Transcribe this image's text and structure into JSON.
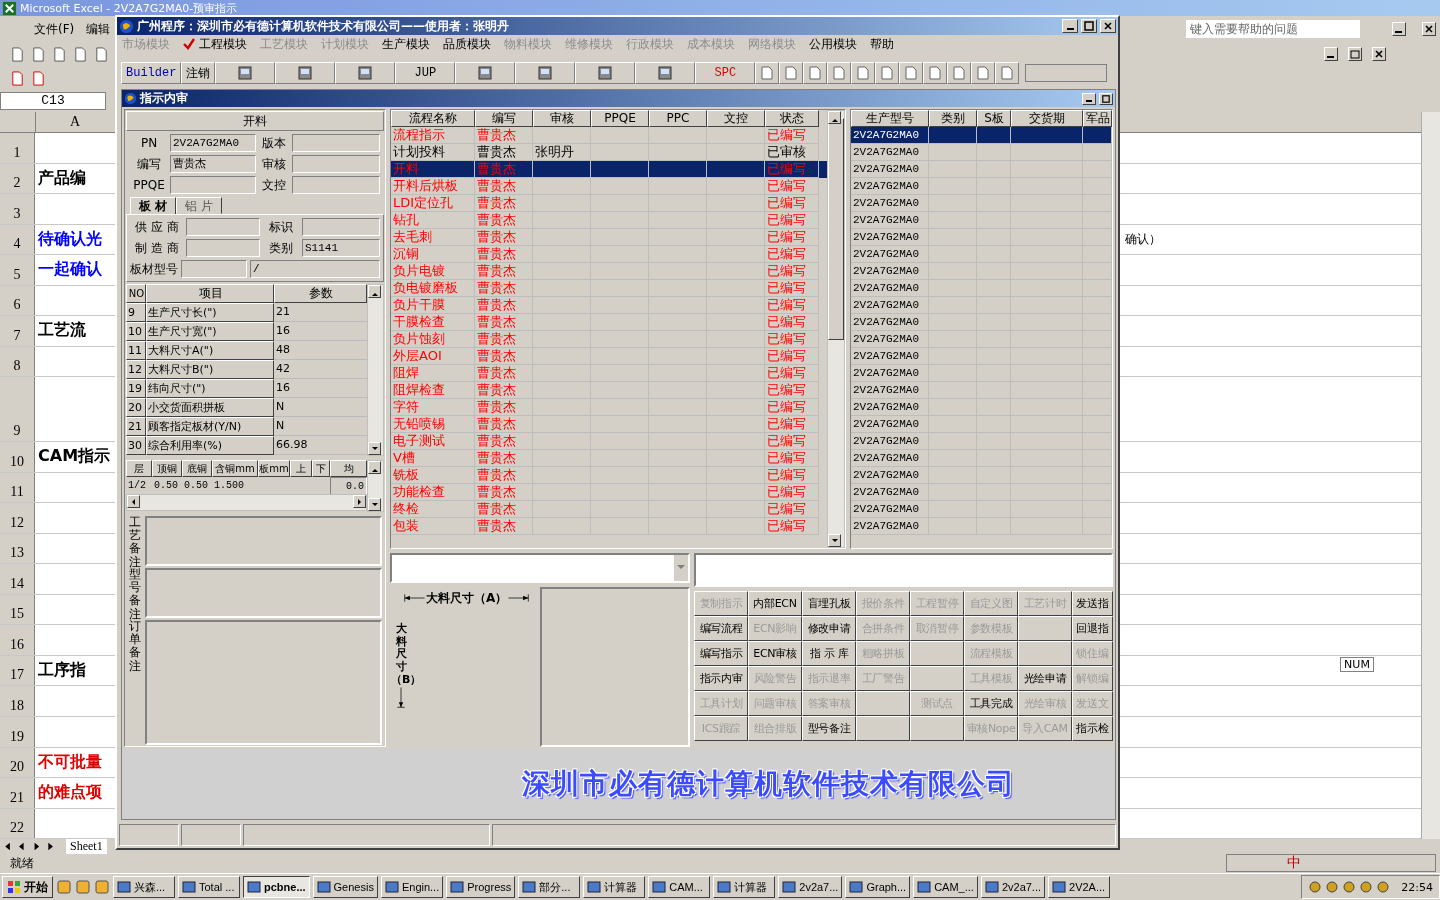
{
  "excel": {
    "title": "Microsoft Excel - 2V2A7G2MA0-预审指示",
    "menu": [
      "文件(F)",
      "编辑"
    ],
    "help_placeholder": "键入需要帮助的问题",
    "name_box": "C13",
    "column": "A",
    "rows": [
      {
        "num": "1"
      },
      {
        "num": "2",
        "text": "产品编",
        "color": "#000000"
      },
      {
        "num": "3"
      },
      {
        "num": "4",
        "text": "待确认光",
        "color": "#0000ff",
        "note": "确认）"
      },
      {
        "num": "5",
        "text": "一起确认",
        "color": "#0000ff"
      },
      {
        "num": "6"
      },
      {
        "num": "7",
        "text": "工艺流",
        "color": "#000000"
      },
      {
        "num": "8"
      },
      {
        "num": "9"
      },
      {
        "num": "10",
        "text": "CAM指示",
        "color": "#000000"
      },
      {
        "num": "11"
      },
      {
        "num": "12"
      },
      {
        "num": "13"
      },
      {
        "num": "14"
      },
      {
        "num": "15"
      },
      {
        "num": "16"
      },
      {
        "num": "17",
        "text": "工序指",
        "color": "#000000"
      },
      {
        "num": "18"
      },
      {
        "num": "19"
      },
      {
        "num": "20",
        "text": "不可批量",
        "color": "#e00000"
      },
      {
        "num": "21",
        "text": "的难点项",
        "color": "#e00000"
      },
      {
        "num": "22"
      }
    ],
    "sheet_tab": "Sheet1",
    "status": "就绪",
    "num_indicator": "NUM"
  },
  "app": {
    "title": "广州程序：深圳市必有德计算机软件技术有限公司——使用者：张明丹",
    "menu": [
      {
        "label": "市场模块",
        "disabled": true,
        "checked": false
      },
      {
        "label": "工程模块",
        "disabled": false,
        "checked": true
      },
      {
        "label": "工艺模块",
        "disabled": true,
        "checked": false
      },
      {
        "label": "计划模块",
        "disabled": true,
        "checked": false
      },
      {
        "label": "生产模块",
        "disabled": false,
        "checked": false
      },
      {
        "label": "品质模块",
        "disabled": false,
        "checked": false
      },
      {
        "label": "物料模块",
        "disabled": true,
        "checked": false
      },
      {
        "label": "维修模块",
        "disabled": true,
        "checked": false
      },
      {
        "label": "行政模块",
        "disabled": true,
        "checked": false
      },
      {
        "label": "成本模块",
        "disabled": true,
        "checked": false
      },
      {
        "label": "网络模块",
        "disabled": true,
        "checked": false
      },
      {
        "label": "公用模块",
        "disabled": false,
        "checked": false
      },
      {
        "label": "帮助",
        "disabled": false,
        "checked": false
      }
    ],
    "toolbar": [
      {
        "kind": "text",
        "label": "Builder",
        "color": "#0000c0"
      },
      {
        "kind": "text",
        "label": "注销",
        "color": "#000000"
      },
      {
        "kind": "icon"
      },
      {
        "kind": "icon"
      },
      {
        "kind": "icon"
      },
      {
        "kind": "text",
        "label": "JUP",
        "color": "#000000"
      },
      {
        "kind": "icon"
      },
      {
        "kind": "icon"
      },
      {
        "kind": "icon"
      },
      {
        "kind": "icon"
      },
      {
        "kind": "text",
        "label": "SPC",
        "color": "#e00000"
      },
      {
        "kind": "small"
      },
      {
        "kind": "small"
      },
      {
        "kind": "small"
      },
      {
        "kind": "small"
      },
      {
        "kind": "small"
      },
      {
        "kind": "small"
      },
      {
        "kind": "small"
      },
      {
        "kind": "small"
      },
      {
        "kind": "small"
      },
      {
        "kind": "small"
      },
      {
        "kind": "small"
      }
    ],
    "child_title": "指示内审"
  },
  "panel": {
    "header": "开料",
    "fields": [
      {
        "label": "PN",
        "value": "2V2A7G2MA0"
      },
      {
        "label": "版本"
      },
      {
        "label": "编写",
        "value": "曹贵杰"
      },
      {
        "label": "审核"
      },
      {
        "label": "PPQE"
      },
      {
        "label": "文控"
      }
    ],
    "tabs": [
      {
        "label": "板 材",
        "selected": true
      },
      {
        "label": "铝 片",
        "selected": false
      }
    ],
    "material_fields": [
      {
        "label": "供 应 商"
      },
      {
        "label": "标识"
      },
      {
        "label": "制 造 商"
      },
      {
        "label": "类别",
        "value": "S1141"
      }
    ],
    "material_type": {
      "label": "板材型号",
      "value_2": "/"
    },
    "params": {
      "columns": [
        "NO",
        "项目",
        "参数"
      ],
      "rows": [
        {
          "no": "9",
          "item": "生产尺寸长(\")",
          "value": "21"
        },
        {
          "no": "10",
          "item": "生产尺寸宽(\")",
          "value": "16"
        },
        {
          "no": "11",
          "item": "大料尺寸A(\")",
          "value": "48"
        },
        {
          "no": "12",
          "item": "大料尺寸B(\")",
          "value": "42"
        },
        {
          "no": "19",
          "item": "纬向尺寸(\")",
          "value": "16"
        },
        {
          "no": "20",
          "item": "小交货面积拼板",
          "value": "N"
        },
        {
          "no": "21",
          "item": "顾客指定板材(Y/N)",
          "value": "N"
        },
        {
          "no": "30",
          "item": "综合利用率(%)",
          "value": "66.98"
        }
      ]
    },
    "layers": {
      "columns": [
        "层",
        "顶铜",
        "底铜",
        "含铜mm",
        "板mm",
        "上",
        "下",
        "均"
      ],
      "row": {
        "layer": "1/2",
        "top_copper": "0.50",
        "bottom_copper": "0.50",
        "copper_thickness": "1.500",
        "average": "0.0"
      }
    },
    "remarks": [
      "工艺备注",
      "型号备注",
      "订单备注"
    ]
  },
  "process": {
    "columns": [
      "流程名称",
      "编写",
      "审核",
      "PPQE",
      "PPC",
      "文控",
      "状态"
    ],
    "rows": [
      {
        "name": "流程指示",
        "writer": "曹贵杰",
        "status": "已编写",
        "reviewed": false,
        "selected": false
      },
      {
        "name": "计划投料",
        "writer": "曹贵杰",
        "reviewer": "张明丹",
        "status": "已审核",
        "reviewed": true,
        "selected": false
      },
      {
        "name": "开料",
        "writer": "曹贵杰",
        "status": "已编写",
        "reviewed": false,
        "selected": true
      },
      {
        "name": "开料后烘板",
        "writer": "曹贵杰",
        "status": "已编写",
        "reviewed": false,
        "selected": false
      },
      {
        "name": "LDI定位孔",
        "writer": "曹贵杰",
        "status": "已编写",
        "reviewed": false,
        "selected": false
      },
      {
        "name": "钻孔",
        "writer": "曹贵杰",
        "status": "已编写",
        "reviewed": false,
        "selected": false
      },
      {
        "name": "去毛刺",
        "writer": "曹贵杰",
        "status": "已编写",
        "reviewed": false,
        "selected": false
      },
      {
        "name": "沉铜",
        "writer": "曹贵杰",
        "status": "已编写",
        "reviewed": false,
        "selected": false
      },
      {
        "name": "负片电镀",
        "writer": "曹贵杰",
        "status": "已编写",
        "reviewed": false,
        "selected": false
      },
      {
        "name": "负电镀磨板",
        "writer": "曹贵杰",
        "status": "已编写",
        "reviewed": false,
        "selected": false
      },
      {
        "name": "负片干膜",
        "writer": "曹贵杰",
        "status": "已编写",
        "reviewed": false,
        "selected": false
      },
      {
        "name": "干膜检查",
        "writer": "曹贵杰",
        "status": "已编写",
        "reviewed": false,
        "selected": false
      },
      {
        "name": "负片蚀刻",
        "writer": "曹贵杰",
        "status": "已编写",
        "reviewed": false,
        "selected": false
      },
      {
        "name": "外层AOI",
        "writer": "曹贵杰",
        "status": "已编写",
        "reviewed": false,
        "selected": false
      },
      {
        "name": "阻焊",
        "writer": "曹贵杰",
        "status": "已编写",
        "reviewed": false,
        "selected": false
      },
      {
        "name": "阻焊检查",
        "writer": "曹贵杰",
        "status": "已编写",
        "reviewed": false,
        "selected": false
      },
      {
        "name": "字符",
        "writer": "曹贵杰",
        "status": "已编写",
        "reviewed": false,
        "selected": false
      },
      {
        "name": "无铅喷锡",
        "writer": "曹贵杰",
        "status": "已编写",
        "reviewed": false,
        "selected": false
      },
      {
        "name": "电子测试",
        "writer": "曹贵杰",
        "status": "已编写",
        "reviewed": false,
        "selected": false
      },
      {
        "name": "V槽",
        "writer": "曹贵杰",
        "status": "已编写",
        "reviewed": false,
        "selected": false
      },
      {
        "name": "铣板",
        "writer": "曹贵杰",
        "status": "已编写",
        "reviewed": false,
        "selected": false
      },
      {
        "name": "功能检查",
        "writer": "曹贵杰",
        "status": "已编写",
        "reviewed": false,
        "selected": false
      },
      {
        "name": "终检",
        "writer": "曹贵杰",
        "status": "已编写",
        "reviewed": false,
        "selected": false
      },
      {
        "name": "包装",
        "writer": "曹贵杰",
        "status": "已编写",
        "reviewed": false,
        "selected": false
      }
    ]
  },
  "models": {
    "columns": [
      "生产型号",
      "类别",
      "S板",
      "交货期",
      "军品"
    ],
    "rows": [
      {
        "model": "2V2A7G2MA0",
        "selected": true
      },
      {
        "model": "2V2A7G2MA0",
        "selected": false
      },
      {
        "model": "2V2A7G2MA0",
        "selected": false
      },
      {
        "model": "2V2A7G2MA0",
        "selected": false
      },
      {
        "model": "2V2A7G2MA0",
        "selected": false
      },
      {
        "model": "2V2A7G2MA0",
        "selected": false
      },
      {
        "model": "2V2A7G2MA0",
        "selected": false
      },
      {
        "model": "2V2A7G2MA0",
        "selected": false
      },
      {
        "model": "2V2A7G2MA0",
        "selected": false
      },
      {
        "model": "2V2A7G2MA0",
        "selected": false
      },
      {
        "model": "2V2A7G2MA0",
        "selected": false
      },
      {
        "model": "2V2A7G2MA0",
        "selected": false
      },
      {
        "model": "2V2A7G2MA0",
        "selected": false
      },
      {
        "model": "2V2A7G2MA0",
        "selected": false
      },
      {
        "model": "2V2A7G2MA0",
        "selected": false
      },
      {
        "model": "2V2A7G2MA0",
        "selected": false
      },
      {
        "model": "2V2A7G2MA0",
        "selected": false
      },
      {
        "model": "2V2A7G2MA0",
        "selected": false
      },
      {
        "model": "2V2A7G2MA0",
        "selected": false
      },
      {
        "model": "2V2A7G2MA0",
        "selected": false
      },
      {
        "model": "2V2A7G2MA0",
        "selected": false
      },
      {
        "model": "2V2A7G2MA0",
        "selected": false
      },
      {
        "model": "2V2A7G2MA0",
        "selected": false
      },
      {
        "model": "2V2A7G2MA0",
        "selected": false
      }
    ]
  },
  "diagram": {
    "label_a": "大料尺寸（A）",
    "label_b": "大料尺寸（B）"
  },
  "buttons": [
    [
      {
        "label": "复制指示",
        "disabled": true
      },
      {
        "label": "内部ECN",
        "disabled": false
      },
      {
        "label": "盲埋孔板",
        "disabled": false
      },
      {
        "label": "报价条件",
        "disabled": true
      },
      {
        "label": "工程暂停",
        "disabled": true
      },
      {
        "label": "自定义图",
        "disabled": true
      },
      {
        "label": "工艺计时",
        "disabled": true
      },
      {
        "label": "发送指",
        "disabled": false
      }
    ],
    [
      {
        "label": "编写流程",
        "disabled": false
      },
      {
        "label": "ECN影响",
        "disabled": true
      },
      {
        "label": "修改申请",
        "disabled": false
      },
      {
        "label": "合拼条件",
        "disabled": true
      },
      {
        "label": "取消暂停",
        "disabled": true
      },
      {
        "label": "参数模板",
        "disabled": true
      },
      {
        "kind": "blank"
      },
      {
        "label": "回退指",
        "disabled": false
      }
    ],
    [
      {
        "label": "编写指示",
        "disabled": false
      },
      {
        "label": "ECN审核",
        "disabled": false
      },
      {
        "label": "指 示 库",
        "disabled": false
      },
      {
        "label": "粗略拼板",
        "disabled": true
      },
      {
        "kind": "blank"
      },
      {
        "label": "流程模板",
        "disabled": true
      },
      {
        "kind": "blank"
      },
      {
        "label": "锁住编",
        "disabled": true
      }
    ],
    [
      {
        "label": "指示内审",
        "disabled": false
      },
      {
        "label": "风险警告",
        "disabled": true
      },
      {
        "label": "指示退率",
        "disabled": true
      },
      {
        "label": "工厂警告",
        "disabled": true
      },
      {
        "kind": "blank"
      },
      {
        "label": "工具模板",
        "disabled": true
      },
      {
        "label": "光绘申请",
        "disabled": false
      },
      {
        "label": "解锁编",
        "disabled": true
      }
    ],
    [
      {
        "label": "工具计划",
        "disabled": true
      },
      {
        "label": "问题审核",
        "disabled": true
      },
      {
        "label": "答案审核",
        "disabled": true
      },
      {
        "kind": "blank"
      },
      {
        "label": "测试点",
        "disabled": true
      },
      {
        "label": "工具完成",
        "disabled": false
      },
      {
        "label": "光绘审核",
        "disabled": true
      },
      {
        "label": "发送文",
        "disabled": true
      }
    ],
    [
      {
        "label": "ICS跟踪",
        "disabled": true
      },
      {
        "label": "组合排版",
        "disabled": true
      },
      {
        "label": "型号备注",
        "disabled": false
      },
      {
        "kind": "blank"
      },
      {
        "kind": "blank"
      },
      {
        "label": "审核Nope",
        "disabled": true
      },
      {
        "label": "导入CAM",
        "disabled": true
      },
      {
        "label": "指示检",
        "disabled": false
      }
    ]
  ],
  "logo": "深圳市必有德计算机软件技术有限公司",
  "taskbar": {
    "start": "开始",
    "ime": "中",
    "clock": "22:54",
    "tasks": [
      {
        "label": "兴森...",
        "selected": false
      },
      {
        "label": "Total ...",
        "selected": false
      },
      {
        "label": "pcbne...",
        "selected": true
      },
      {
        "label": "Genesis",
        "selected": false
      },
      {
        "label": "Engin...",
        "selected": false
      },
      {
        "label": "Progress",
        "selected": false
      },
      {
        "label": "部分...",
        "selected": false
      },
      {
        "label": "计算器",
        "selected": false
      },
      {
        "label": "CAM...",
        "selected": false
      },
      {
        "label": "计算器",
        "selected": false
      },
      {
        "label": "2v2a7...",
        "selected": false
      },
      {
        "label": "Graph...",
        "selected": false
      },
      {
        "label": "CAM_...",
        "selected": false
      },
      {
        "label": "2v2a7...",
        "selected": false
      },
      {
        "label": "2V2A...",
        "selected": false
      }
    ]
  }
}
